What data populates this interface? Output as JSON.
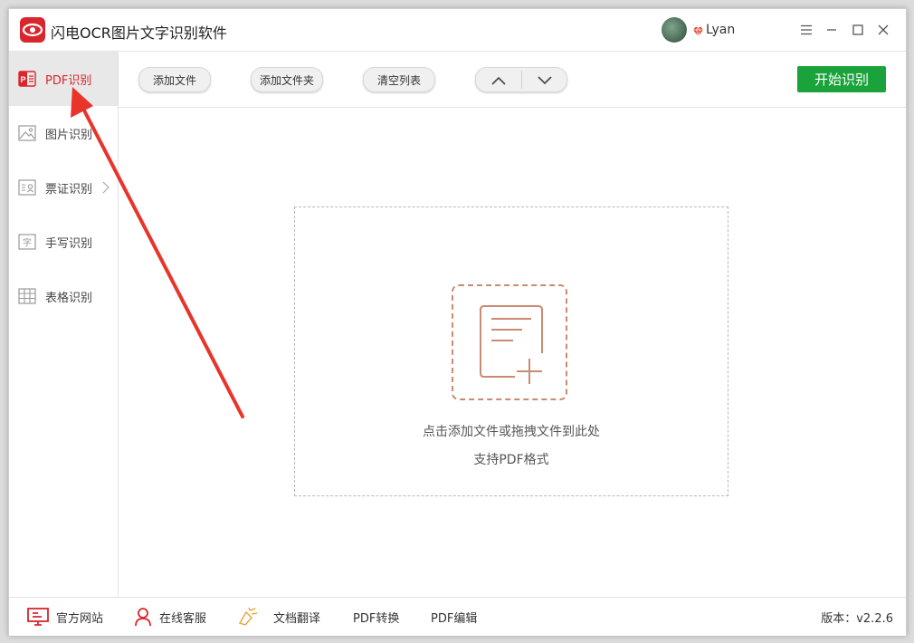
{
  "app": {
    "title": "闪电OCR图片文字识别软件",
    "username": "Lyan"
  },
  "sidebar": {
    "items": [
      {
        "label": "PDF识别",
        "icon": "pdf-icon",
        "active": true
      },
      {
        "label": "图片识别",
        "icon": "image-icon"
      },
      {
        "label": "票证识别",
        "icon": "ticket-icon",
        "has_submenu": true
      },
      {
        "label": "手写识别",
        "icon": "handwriting-icon"
      },
      {
        "label": "表格识别",
        "icon": "table-icon"
      }
    ]
  },
  "toolbar": {
    "add_file": "添加文件",
    "add_folder": "添加文件夹",
    "clear_list": "清空列表",
    "start": "开始识别"
  },
  "dropzone": {
    "hint": "点击添加文件或拖拽文件到此处",
    "support": "支持PDF格式"
  },
  "footer": {
    "website": "官方网站",
    "support": "在线客服",
    "translate": "文档翻译",
    "pdf_convert": "PDF转换",
    "pdf_edit": "PDF编辑",
    "version": "版本：v2.2.6"
  },
  "colors": {
    "brand": "#d9262c",
    "start_button": "#1aa33a",
    "drop_icon": "#c98b72",
    "annotation_arrow": "#e8342a"
  }
}
